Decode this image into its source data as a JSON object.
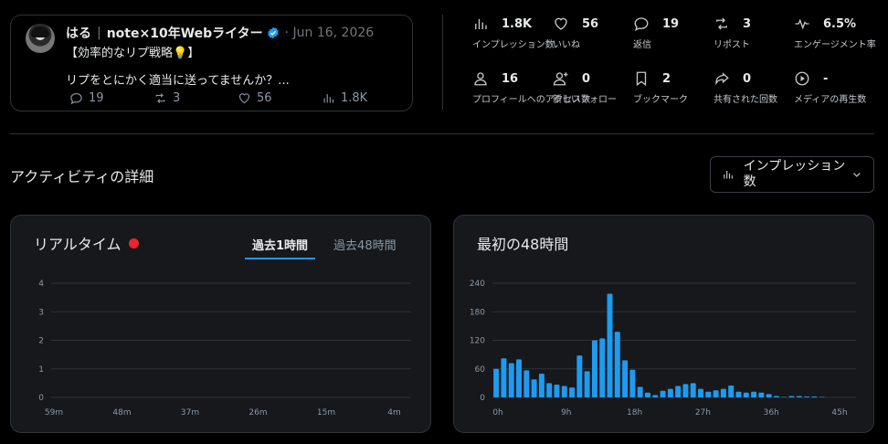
{
  "tweet": {
    "author_name": "はる",
    "author_brand": "note×10年Webライター",
    "date": "Jun 16, 2026",
    "line1": "【効率的なリプ戦略",
    "line1_emoji": "💡",
    "line1_end": "】",
    "line2": "リプをとにかく適当に送ってませんか？...",
    "replies": "19",
    "reposts": "3",
    "likes": "56",
    "views": "1.8K"
  },
  "metrics": [
    {
      "icon": "bar-chart-icon",
      "value": "1.8K",
      "label": "インプレッション数"
    },
    {
      "icon": "heart-icon",
      "value": "56",
      "label": "いいね"
    },
    {
      "icon": "reply-icon",
      "value": "19",
      "label": "返信"
    },
    {
      "icon": "repost-icon",
      "value": "3",
      "label": "リポスト"
    },
    {
      "icon": "pulse-icon",
      "value": "6.5%",
      "label": "エンゲージメント率"
    },
    {
      "icon": "profile-icon",
      "value": "16",
      "label": "プロフィールへのアクセス数"
    },
    {
      "icon": "follow-icon",
      "value": "0",
      "label": "新しいフォロー"
    },
    {
      "icon": "bookmark-icon",
      "value": "2",
      "label": "ブックマーク"
    },
    {
      "icon": "share-icon",
      "value": "0",
      "label": "共有された回数"
    },
    {
      "icon": "play-icon",
      "value": "-",
      "label": "メディアの再生数"
    }
  ],
  "activity": {
    "title": "アクティビティの詳細",
    "dropdown_value": "インプレッション数"
  },
  "realtime": {
    "title": "リアルタイム",
    "tabs": [
      "過去1時間",
      "過去48時間"
    ],
    "active_tab": 0
  },
  "first48": {
    "title": "最初の48時間"
  },
  "colors": {
    "accent": "#1d9bf0",
    "live": "#f4212e",
    "bar": "#1d9bf0"
  },
  "chart_data": [
    {
      "type": "bar",
      "x_ticks": [
        "59m",
        "48m",
        "37m",
        "26m",
        "15m",
        "4m"
      ],
      "y_ticks": [
        "0",
        "1",
        "2",
        "3",
        "4"
      ],
      "ylim": [
        0,
        4
      ],
      "x": [],
      "values": [],
      "grid": true
    },
    {
      "type": "bar",
      "x_ticks": [
        "0h",
        "9h",
        "18h",
        "27h",
        "36h",
        "45h"
      ],
      "y_ticks": [
        "0",
        "60",
        "120",
        "180",
        "240"
      ],
      "ylim": [
        0,
        240
      ],
      "x": [
        0,
        1,
        2,
        3,
        4,
        5,
        6,
        7,
        8,
        9,
        10,
        11,
        12,
        13,
        14,
        15,
        16,
        17,
        18,
        19,
        20,
        21,
        22,
        23,
        24,
        25,
        26,
        27,
        28,
        29,
        30,
        31,
        32,
        33,
        34,
        35,
        36,
        37,
        38,
        39,
        40,
        41,
        42,
        43,
        44,
        45,
        46,
        47
      ],
      "values": [
        60,
        82,
        72,
        80,
        57,
        38,
        50,
        30,
        27,
        24,
        21,
        88,
        55,
        120,
        124,
        218,
        138,
        78,
        58,
        22,
        10,
        5,
        14,
        18,
        24,
        28,
        30,
        18,
        12,
        15,
        18,
        25,
        12,
        10,
        12,
        10,
        7,
        3,
        1,
        3,
        3,
        2,
        2,
        1,
        0,
        0,
        0,
        0
      ],
      "grid": true
    }
  ]
}
